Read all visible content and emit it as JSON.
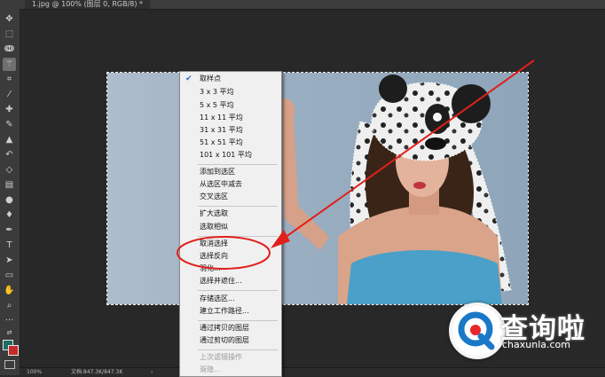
{
  "document": {
    "tab_title": "1.jpg @ 100% (图层 0, RGB/8) *",
    "zoom": "100%",
    "doc_info": "文档:847.3K/847.3K"
  },
  "toolbar": {
    "tools": [
      "move-tool",
      "marquee-tool",
      "lasso-tool",
      "magic-wand-tool",
      "crop-tool",
      "eyedropper-tool",
      "healing-brush-tool",
      "brush-tool",
      "clone-stamp-tool",
      "history-brush-tool",
      "eraser-tool",
      "gradient-tool",
      "blur-tool",
      "dodge-tool",
      "pen-tool",
      "type-tool",
      "path-selection-tool",
      "shape-tool",
      "hand-tool",
      "zoom-tool",
      "more-tools"
    ],
    "foreground_color": "#1b6b63",
    "background_color": "#c72a2a"
  },
  "context_menu": {
    "items": [
      {
        "label": "取样点",
        "checked": true,
        "enabled": true
      },
      {
        "label": "3 x 3 平均",
        "enabled": true
      },
      {
        "label": "5 x 5 平均",
        "enabled": true
      },
      {
        "label": "11 x 11 平均",
        "enabled": true
      },
      {
        "label": "31 x 31 平均",
        "enabled": true
      },
      {
        "label": "51 x 51 平均",
        "enabled": true
      },
      {
        "label": "101 x 101 平均",
        "enabled": true
      },
      {
        "label": "添加到选区",
        "enabled": true
      },
      {
        "label": "从选区中减去",
        "enabled": true
      },
      {
        "label": "交叉选区",
        "enabled": true
      },
      {
        "label": "扩大选取",
        "enabled": true
      },
      {
        "label": "选取相似",
        "enabled": true
      },
      {
        "label": "取消选择",
        "enabled": true
      },
      {
        "label": "选择反向",
        "enabled": true,
        "highlighted_by_annotation": true
      },
      {
        "label": "羽化...",
        "enabled": true
      },
      {
        "label": "选择并遮住...",
        "enabled": true
      },
      {
        "label": "存储选区...",
        "enabled": true
      },
      {
        "label": "建立工作路径...",
        "enabled": true
      },
      {
        "label": "通过拷贝的图层",
        "enabled": true
      },
      {
        "label": "通过剪切的图层",
        "enabled": true
      },
      {
        "label": "上次滤镜操作",
        "enabled": false
      },
      {
        "label": "渐隐...",
        "enabled": false
      }
    ]
  },
  "watermark": {
    "title": "查询啦",
    "url": "chaxunla.com",
    "accent": "#1a78c8",
    "accent2": "#e8272b"
  },
  "annotation": {
    "color": "#e0201c"
  }
}
